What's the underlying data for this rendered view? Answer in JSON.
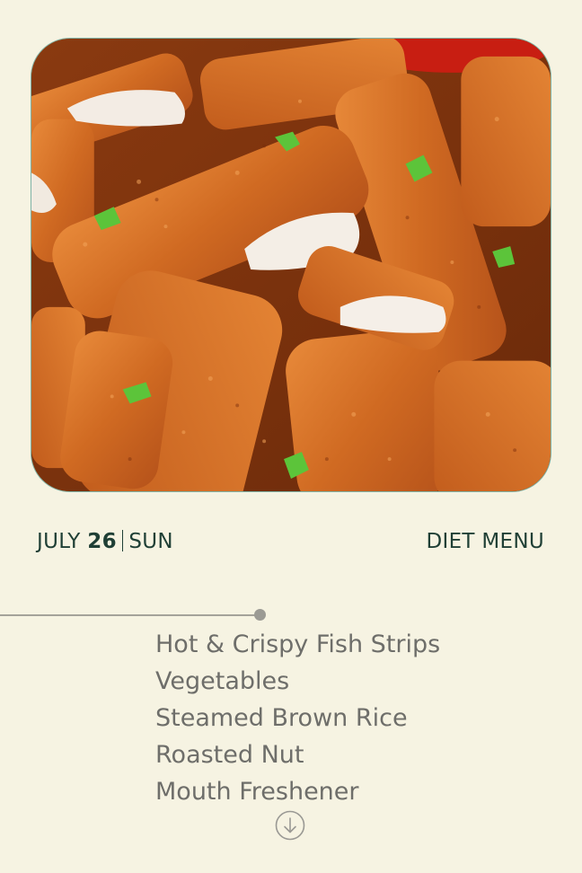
{
  "hero": {
    "icon": "fish-strips-photo"
  },
  "date": {
    "month": "JULY",
    "day": "26",
    "weekday": "SUN"
  },
  "header": {
    "menu_label": "DIET MENU"
  },
  "menu": {
    "items": [
      "Hot & Crispy Fish Strips",
      "Vegetables",
      "Steamed Brown Rice",
      "Roasted Nut",
      "Mouth Freshener"
    ]
  },
  "scroll": {
    "icon": "arrow-down-circle-icon"
  },
  "colors": {
    "background": "#f6f3e2",
    "heading": "#1f3f35",
    "menu_text": "#6e6e6a",
    "photo_border": "#7fb3a7"
  }
}
